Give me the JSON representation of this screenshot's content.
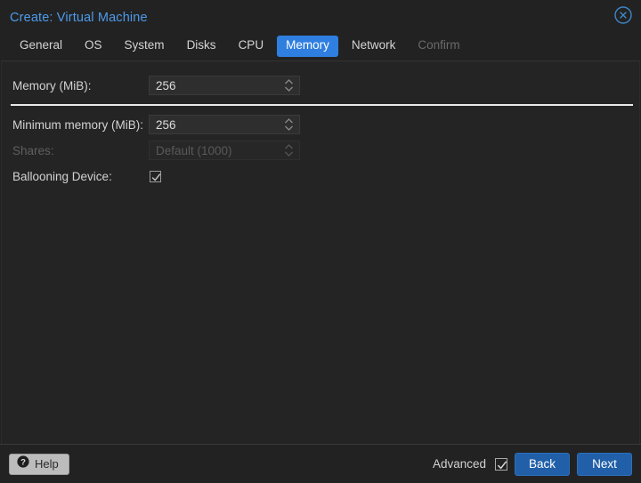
{
  "window": {
    "title": "Create: Virtual Machine",
    "close_icon": "close-circle-icon",
    "accent_color": "#2f7fe0",
    "title_color": "#4d9bea",
    "background": "#222222"
  },
  "tabs": [
    {
      "label": "General",
      "state": "normal"
    },
    {
      "label": "OS",
      "state": "normal"
    },
    {
      "label": "System",
      "state": "normal"
    },
    {
      "label": "Disks",
      "state": "normal"
    },
    {
      "label": "CPU",
      "state": "normal"
    },
    {
      "label": "Memory",
      "state": "active"
    },
    {
      "label": "Network",
      "state": "normal"
    },
    {
      "label": "Confirm",
      "state": "disabled"
    }
  ],
  "form": {
    "memory": {
      "label": "Memory (MiB):",
      "value": "256",
      "spinner_icon": "spinner-updown-icon"
    },
    "minimum_memory": {
      "label": "Minimum memory (MiB):",
      "value": "256",
      "spinner_icon": "spinner-updown-icon"
    },
    "shares": {
      "label": "Shares:",
      "placeholder": "Default (1000)",
      "value": "",
      "disabled": true,
      "spinner_icon": "spinner-updown-icon"
    },
    "ballooning_device": {
      "label": "Ballooning Device:",
      "checked": true,
      "check_icon": "checkmark-icon"
    }
  },
  "footer": {
    "help_label": "Help",
    "help_icon": "question-circle-icon",
    "advanced_label": "Advanced",
    "advanced_checked": true,
    "advanced_check_icon": "checkmark-icon",
    "back_label": "Back",
    "next_label": "Next",
    "button_color": "#2160a8"
  }
}
